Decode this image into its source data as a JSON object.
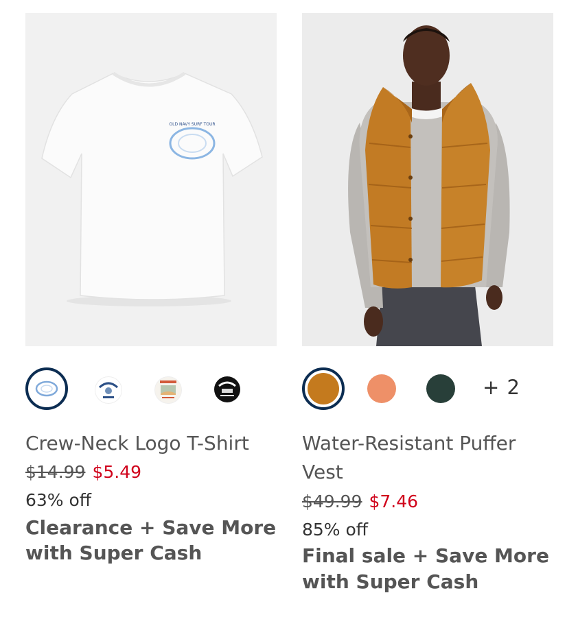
{
  "products": [
    {
      "title": "Crew-Neck Logo T-Shirt",
      "old_price": "$14.99",
      "sale_price": "$5.49",
      "percent_off": "63% off",
      "promo_line1": "Clearance + Save More",
      "promo_line2": "with Super Cash",
      "image_description": "white t-shirt with small Old Navy logo on chest",
      "swatches": [
        {
          "name": "white-logo-tee",
          "selected": true
        },
        {
          "name": "old-navy-sf-ca-logo",
          "selected": false
        },
        {
          "name": "old-navy-beach-graphic",
          "selected": false
        },
        {
          "name": "old-navy-california-black",
          "selected": false
        }
      ],
      "shirt_print_text": "OLD NAVY SURF TOUR"
    },
    {
      "title_line1": "Water-Resistant Puffer",
      "title_line2": "Vest",
      "old_price": "$49.99",
      "sale_price": "$7.46",
      "percent_off": "85% off",
      "promo_line1": "Final sale + Save More",
      "promo_line2": "with Super Cash",
      "swatches": [
        {
          "name": "orange-brown",
          "color": "#c47a1e",
          "selected": true
        },
        {
          "name": "peach",
          "color": "#ee9068",
          "selected": false
        },
        {
          "name": "dark-green",
          "color": "#283f39",
          "selected": false
        }
      ],
      "more_colors": "+ 2"
    }
  ],
  "colors": {
    "sale_red": "#d0021b",
    "selected_ring": "#0c2d52",
    "text_gray": "#555555"
  }
}
